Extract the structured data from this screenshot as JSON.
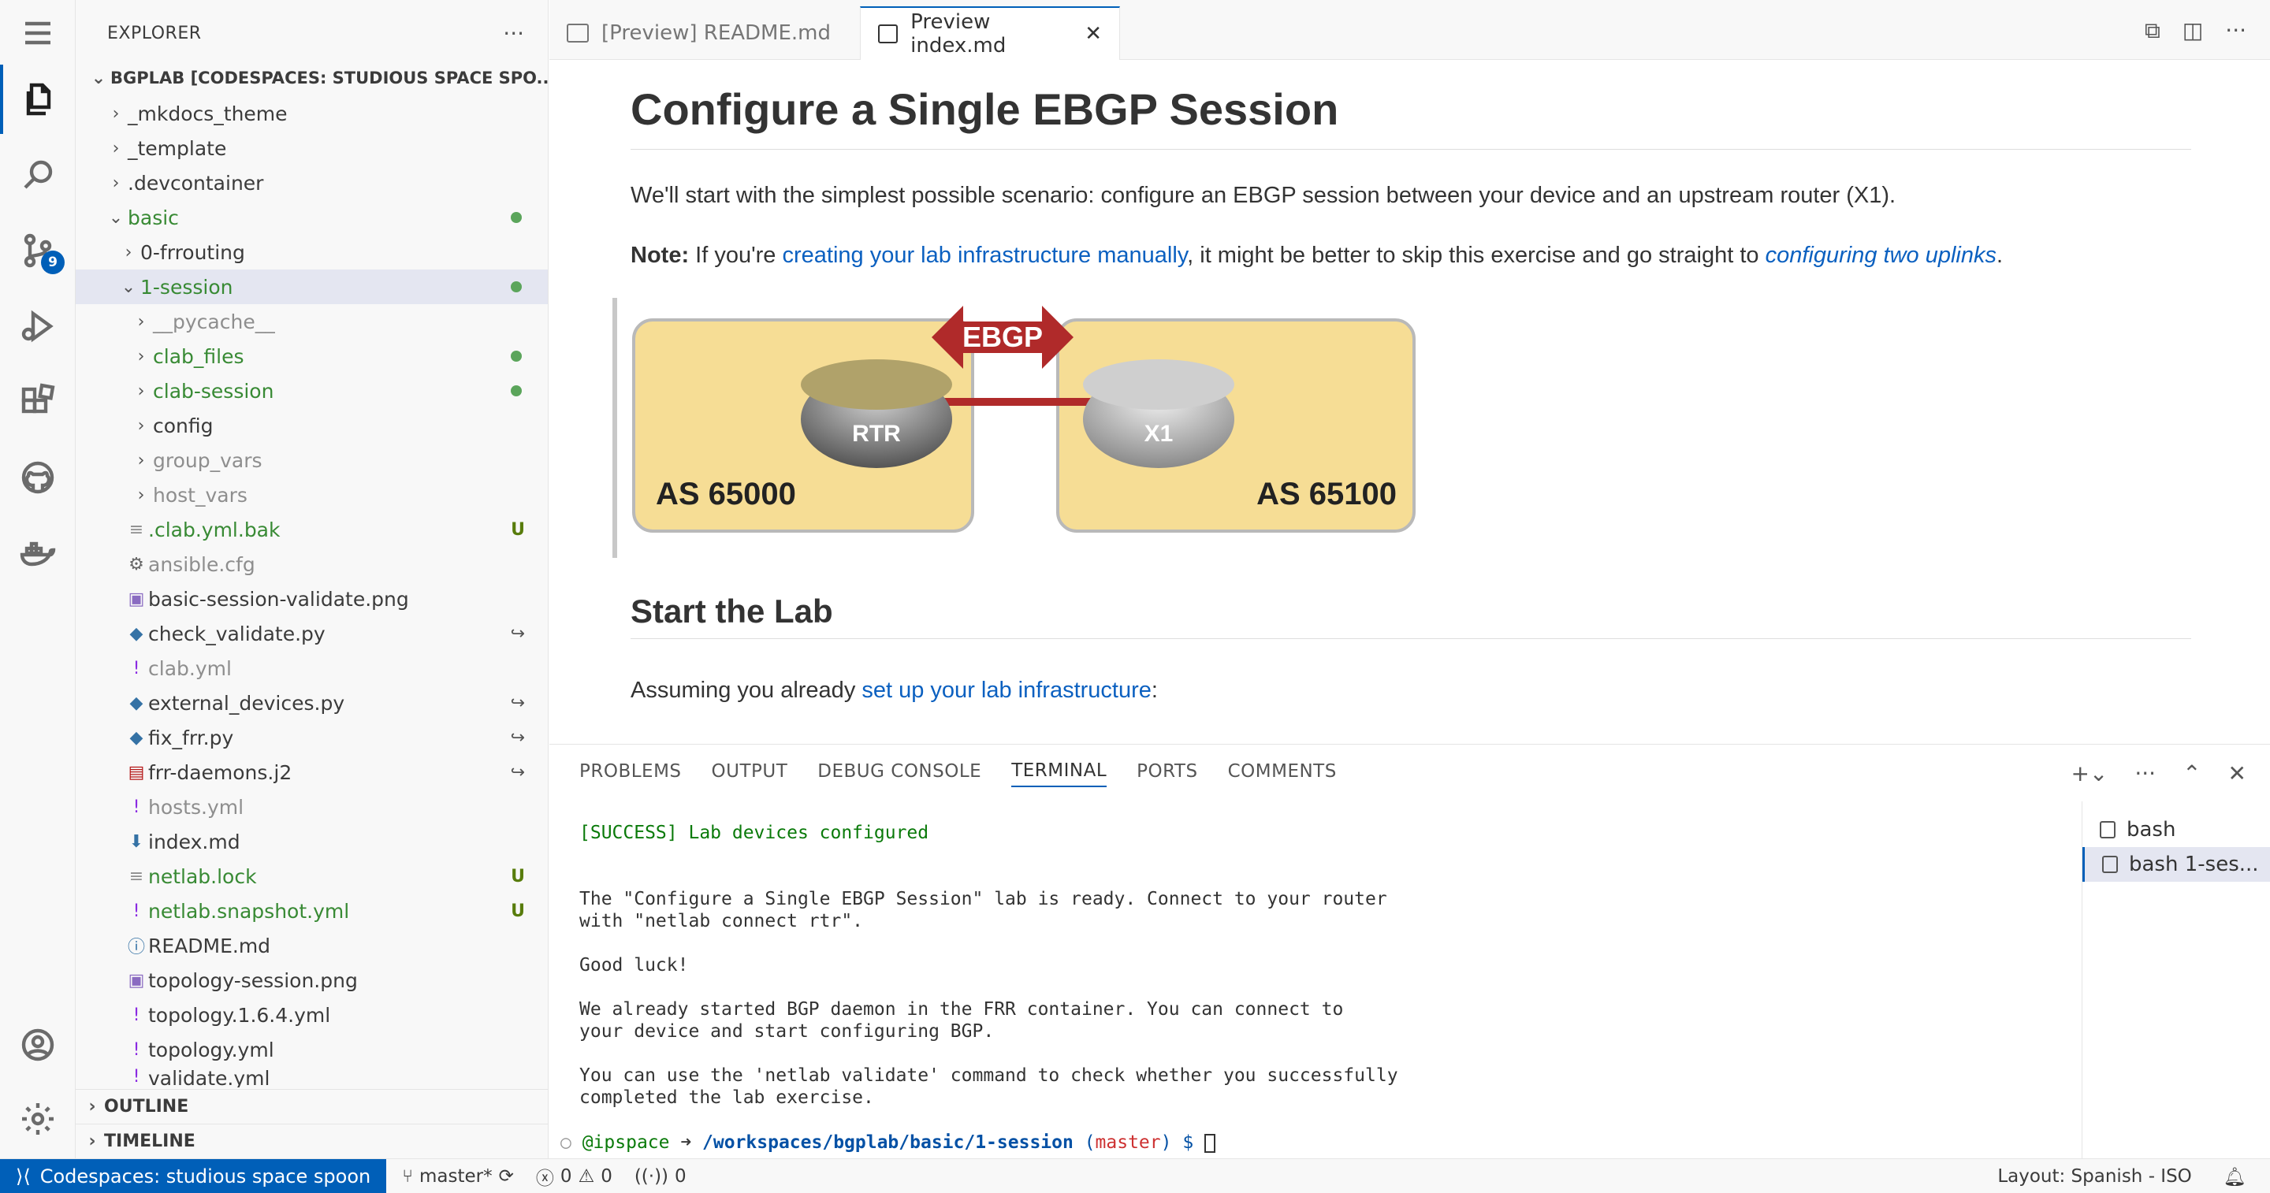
{
  "sidebar": {
    "title": "EXPLORER",
    "more": "···",
    "root": "BGPLAB [CODESPACES: STUDIOUS SPACE SPO...",
    "items": [
      {
        "label": "_mkdocs_theme"
      },
      {
        "label": "_template"
      },
      {
        "label": ".devcontainer"
      },
      {
        "label": "basic"
      },
      {
        "label": "0-frrouting"
      },
      {
        "label": "1-session"
      },
      {
        "label": "__pycache__"
      },
      {
        "label": "clab_files"
      },
      {
        "label": "clab-session"
      },
      {
        "label": "config"
      },
      {
        "label": "group_vars"
      },
      {
        "label": "host_vars"
      },
      {
        "label": ".clab.yml.bak",
        "status": "U"
      },
      {
        "label": "ansible.cfg"
      },
      {
        "label": "basic-session-validate.png"
      },
      {
        "label": "check_validate.py"
      },
      {
        "label": "clab.yml"
      },
      {
        "label": "external_devices.py"
      },
      {
        "label": "fix_frr.py"
      },
      {
        "label": "frr-daemons.j2"
      },
      {
        "label": "hosts.yml"
      },
      {
        "label": "index.md"
      },
      {
        "label": "netlab.lock",
        "status": "U"
      },
      {
        "label": "netlab.snapshot.yml",
        "status": "U"
      },
      {
        "label": "README.md"
      },
      {
        "label": "topology-session.png"
      },
      {
        "label": "topology.1.6.4.yml"
      },
      {
        "label": "topology.yml"
      },
      {
        "label": "validate.yml"
      }
    ],
    "outline": "OUTLINE",
    "timeline": "TIMELINE"
  },
  "activity": {
    "scm_badge": "9"
  },
  "tabs": [
    {
      "label": "[Preview] README.md"
    },
    {
      "label": "Preview index.md"
    }
  ],
  "preview": {
    "h1": "Configure a Single EBGP Session",
    "intro": "We'll start with the simplest possible scenario: configure an EBGP session between your device and an upstream router (X1).",
    "note_label": "Note:",
    "note_pre": " If you're ",
    "note_link": "creating your lab infrastructure manually",
    "note_mid": ", it might be better to skip this exercise and go straight to ",
    "note_link2": "configuring two uplinks",
    "note_end": ".",
    "diagram": {
      "ebgp": "EBGP",
      "rtr": "RTR",
      "x1": "X1",
      "as_left": "AS 65000",
      "as_right": "AS 65100"
    },
    "h2": "Start the Lab",
    "assume_pre": "Assuming you already ",
    "assume_link": "set up your lab infrastructure",
    "assume_end": ":"
  },
  "panel": {
    "tabs": [
      "PROBLEMS",
      "OUTPUT",
      "DEBUG CONSOLE",
      "TERMINAL",
      "PORTS",
      "COMMENTS"
    ],
    "terminal_lines": [
      "[SUCCESS] Lab devices configured",
      "",
      "",
      "The \"Configure a Single EBGP Session\" lab is ready. Connect to your router",
      "with \"netlab connect rtr\".",
      "",
      "Good luck!",
      "",
      "We already started BGP daemon in the FRR container. You can connect to",
      "your device and start configuring BGP.",
      "",
      "You can use the 'netlab validate' command to check whether you successfully",
      "completed the lab exercise."
    ],
    "prompt_user": "@ipspace",
    "prompt_arrow": " ➜ ",
    "prompt_path": "/workspaces/bgplab/basic/1-session",
    "prompt_branch_open": " (",
    "prompt_branch": "master",
    "prompt_branch_close": ") $ ",
    "terminals": [
      "bash",
      "bash 1-ses..."
    ]
  },
  "status": {
    "remote": "Codespaces: studious space spoon",
    "branch": "master*",
    "errors": "0",
    "warnings": "0",
    "ports": "0",
    "layout": "Layout: Spanish - ISO"
  }
}
